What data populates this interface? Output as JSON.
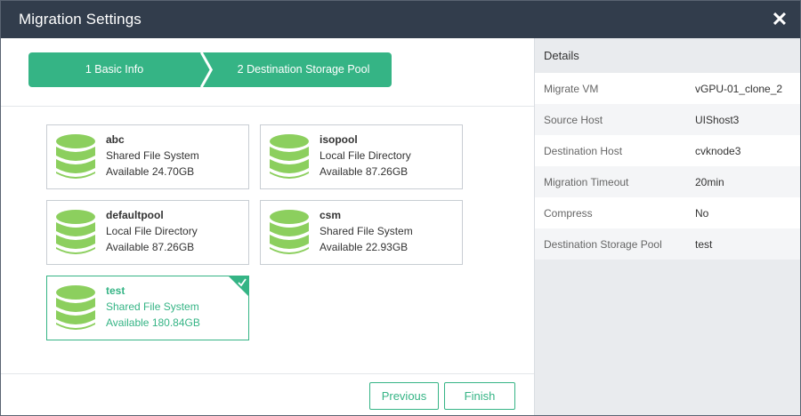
{
  "dialog": {
    "title": "Migration Settings",
    "close_icon": "close-icon"
  },
  "steps": [
    {
      "label": "1 Basic Info"
    },
    {
      "label": "2 Destination Storage Pool"
    }
  ],
  "pools": [
    {
      "name": "abc",
      "type": "Shared File System",
      "available": "Available 24.70GB",
      "selected": false
    },
    {
      "name": "isopool",
      "type": "Local File Directory",
      "available": "Available 87.26GB",
      "selected": false
    },
    {
      "name": "defaultpool",
      "type": "Local File Directory",
      "available": "Available 87.26GB",
      "selected": false
    },
    {
      "name": "csm",
      "type": "Shared File System",
      "available": "Available 22.93GB",
      "selected": false
    },
    {
      "name": "test",
      "type": "Shared File System",
      "available": "Available 180.84GB",
      "selected": true
    }
  ],
  "buttons": {
    "previous": "Previous",
    "finish": "Finish"
  },
  "details": {
    "heading": "Details",
    "rows": [
      {
        "key": "Migrate VM",
        "value": "vGPU-01_clone_2"
      },
      {
        "key": "Source Host",
        "value": "UIShost3"
      },
      {
        "key": "Destination Host",
        "value": "cvknode3"
      },
      {
        "key": "Migration Timeout",
        "value": "20min"
      },
      {
        "key": "Compress",
        "value": "No"
      },
      {
        "key": "Destination Storage Pool",
        "value": "test"
      }
    ]
  },
  "colors": {
    "accent": "#35b485",
    "titlebar": "#323d4c",
    "database_icon": "#8ccf5e",
    "panel_bg": "#e9ebee"
  },
  "icons": {
    "pool_icon": "database-icon",
    "selected_icon": "checkmark-icon",
    "step_separator": "chevron-right-icon"
  }
}
